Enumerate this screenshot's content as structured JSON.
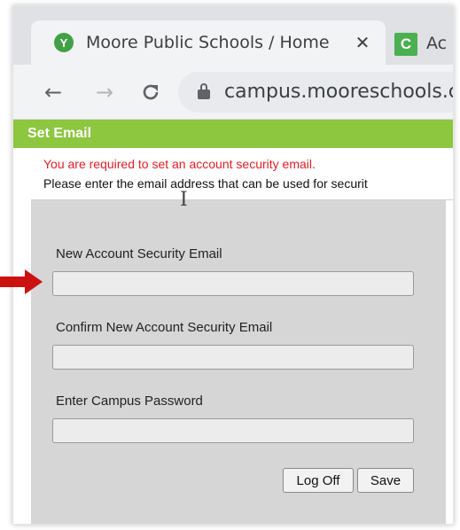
{
  "browser": {
    "active_tab": {
      "title": "Moore Public Schools / Home",
      "favicon": "moore-schools-logo-icon",
      "close": "✕"
    },
    "second_tab": {
      "title": "Ac",
      "favicon_letter": "C"
    },
    "url": "campus.mooreschools.cc",
    "icons": {
      "back": "←",
      "forward": "→",
      "reload": "C"
    }
  },
  "page": {
    "header": "Set Email",
    "warning": "You are required to set an account security email.",
    "info": "Please enter the email address that can be used for securit",
    "fields": [
      {
        "label": "New Account Security Email",
        "value": ""
      },
      {
        "label": "Confirm New Account Security Email",
        "value": ""
      },
      {
        "label": "Enter Campus Password",
        "value": ""
      }
    ],
    "buttons": {
      "log_off": "Log Off",
      "save": "Save"
    }
  },
  "colors": {
    "header_green": "#8dc63f",
    "warning_red": "#e01e26",
    "annotation_arrow": "#cc1111"
  }
}
